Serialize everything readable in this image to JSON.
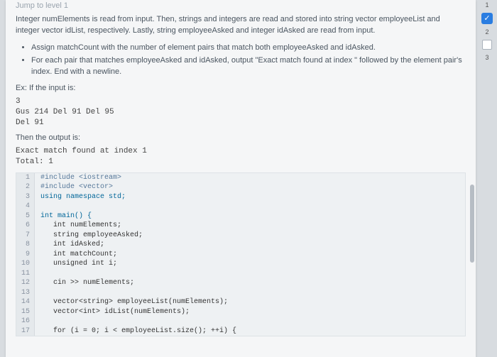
{
  "header_cut": "Jump to level 1",
  "intro": "Integer numElements is read from input. Then, strings and integers are read and stored into string vector employeeList and integer vector idList, respectively. Lastly, string employeeAsked and integer idAsked are read from input.",
  "bullets": [
    "Assign matchCount with the number of element pairs that match both employeeAsked and idAsked.",
    "For each pair that matches employeeAsked and idAsked, output \"Exact match found at index \" followed by the element pair's index. End with a newline."
  ],
  "ex_label": "Ex: If the input is:",
  "example_input": "3\nGus 214 Del 91 Del 95\nDel 91",
  "then_label": "Then the output is:",
  "example_output": "Exact match found at index 1\nTotal: 1",
  "code_lines": [
    {
      "n": 1,
      "t": "#include <iostream>",
      "cls": "pp"
    },
    {
      "n": 2,
      "t": "#include <vector>",
      "cls": "pp"
    },
    {
      "n": 3,
      "t": "using namespace std;",
      "cls": "kw"
    },
    {
      "n": 4,
      "t": "",
      "cls": ""
    },
    {
      "n": 5,
      "t": "int main() {",
      "cls": "ty"
    },
    {
      "n": 6,
      "t": "   int numElements;",
      "cls": ""
    },
    {
      "n": 7,
      "t": "   string employeeAsked;",
      "cls": ""
    },
    {
      "n": 8,
      "t": "   int idAsked;",
      "cls": ""
    },
    {
      "n": 9,
      "t": "   int matchCount;",
      "cls": ""
    },
    {
      "n": 10,
      "t": "   unsigned int i;",
      "cls": ""
    },
    {
      "n": 11,
      "t": "",
      "cls": ""
    },
    {
      "n": 12,
      "t": "   cin >> numElements;",
      "cls": ""
    },
    {
      "n": 13,
      "t": "",
      "cls": ""
    },
    {
      "n": 14,
      "t": "   vector<string> employeeList(numElements);",
      "cls": ""
    },
    {
      "n": 15,
      "t": "   vector<int> idList(numElements);",
      "cls": ""
    },
    {
      "n": 16,
      "t": "",
      "cls": ""
    },
    {
      "n": 17,
      "t": "   for (i = 0; i < employeeList.size(); ++i) {",
      "cls": ""
    }
  ],
  "side": {
    "num1": "1",
    "num2": "2",
    "num3": "3"
  }
}
